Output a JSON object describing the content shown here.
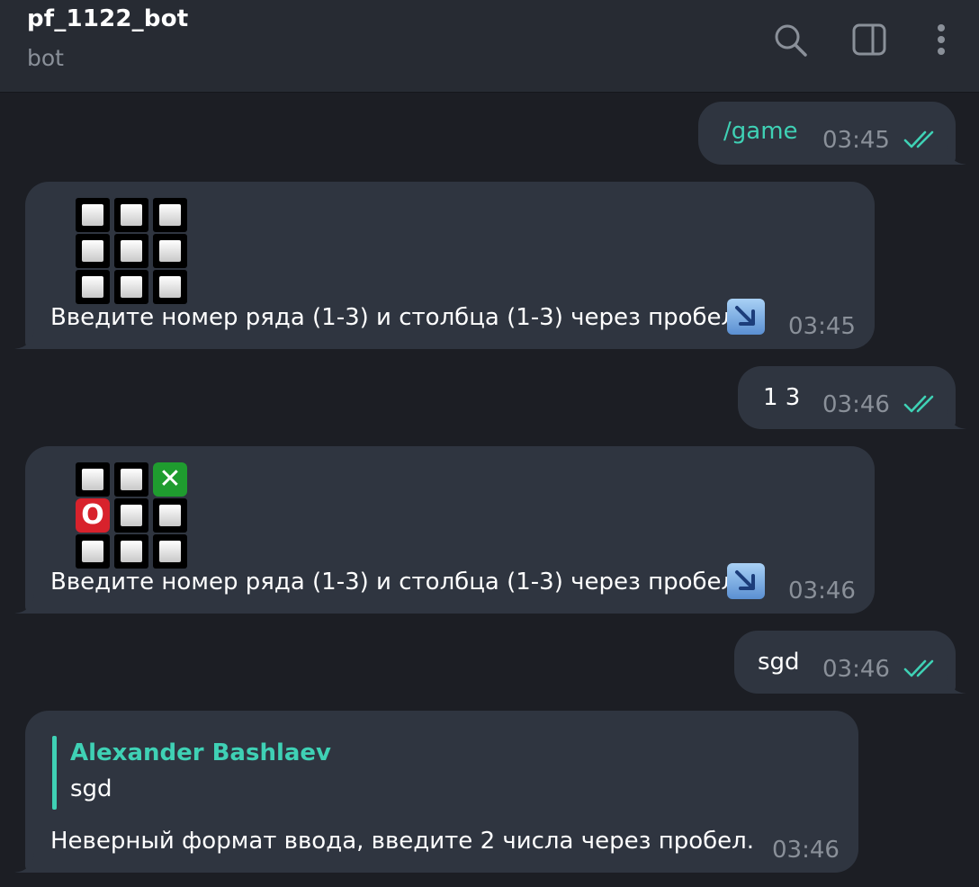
{
  "header": {
    "title": "pf_1122_bot",
    "subtitle": "bot",
    "icons": [
      "search-icon",
      "sidebar-toggle-icon",
      "more-vertical-icon"
    ]
  },
  "messages": [
    {
      "direction": "outgoing",
      "text": "/game",
      "is_command": true,
      "time": "03:45",
      "status": "read"
    },
    {
      "direction": "incoming",
      "board": [
        [
          "empty",
          "empty",
          "empty"
        ],
        [
          "empty",
          "empty",
          "empty"
        ],
        [
          "empty",
          "empty",
          "empty"
        ]
      ],
      "text": "Введите номер ряда (1-3) и столбца (1-3) через пробел",
      "emoji": "arrow-down-right-emoji",
      "time": "03:45"
    },
    {
      "direction": "outgoing",
      "text": "1 3",
      "time": "03:46",
      "status": "read"
    },
    {
      "direction": "incoming",
      "board": [
        [
          "empty",
          "empty",
          "x"
        ],
        [
          "o",
          "empty",
          "empty"
        ],
        [
          "empty",
          "empty",
          "empty"
        ]
      ],
      "text": "Введите номер ряда (1-3) и столбца (1-3) через пробел",
      "emoji": "arrow-down-right-emoji",
      "time": "03:46"
    },
    {
      "direction": "outgoing",
      "text": "sgd",
      "time": "03:46",
      "status": "read"
    },
    {
      "direction": "incoming",
      "reply": {
        "author": "Alexander Bashlaev",
        "text": "sgd"
      },
      "text": "Неверный формат ввода, введите 2 числа через пробел.",
      "time": "03:46"
    }
  ],
  "marks": {
    "x": "✕",
    "o": "O"
  },
  "colors": {
    "background": "#1c1e24",
    "header": "#272b33",
    "bubble": "#2f3540",
    "accent": "#3fd1b5",
    "muted": "#8a9099"
  }
}
